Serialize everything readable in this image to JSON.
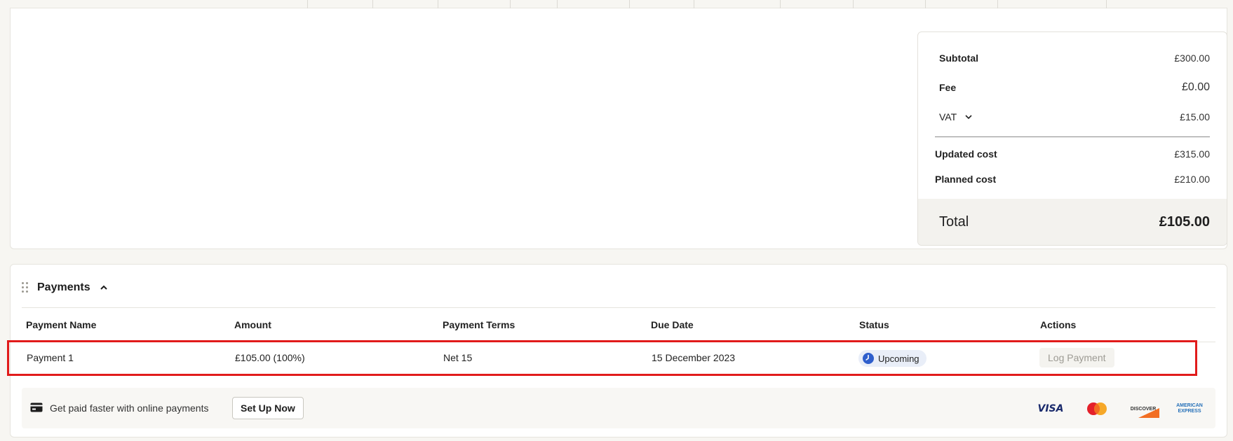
{
  "summary": {
    "subtotal_label": "Subtotal",
    "subtotal_value": "£300.00",
    "fee_label": "Fee",
    "fee_value": "£0.00",
    "vat_label": "VAT",
    "vat_value": "£15.00",
    "updated_cost_label": "Updated cost",
    "updated_cost_value": "£315.00",
    "planned_cost_label": "Planned cost",
    "planned_cost_value": "£210.00",
    "total_label": "Total",
    "total_value": "£105.00"
  },
  "payments": {
    "title": "Payments",
    "columns": [
      "Payment Name",
      "Amount",
      "Payment Terms",
      "Due Date",
      "Status",
      "Actions"
    ],
    "rows": [
      {
        "name": "Payment 1",
        "amount": "£105.00 (100%)",
        "terms": "Net 15",
        "due_date": "15 December 2023",
        "status": "Upcoming",
        "action": "Log Payment"
      }
    ],
    "banner_text": "Get paid faster with online payments",
    "setup_label": "Set Up Now",
    "card_brands": [
      "VISA",
      "MasterCard",
      "DISCOVER",
      "AMERICAN EXPRESS"
    ]
  },
  "colors": {
    "highlight": "#e11b1b",
    "status_pill_bg": "#e9eef8",
    "status_icon": "#2f5fcc"
  }
}
